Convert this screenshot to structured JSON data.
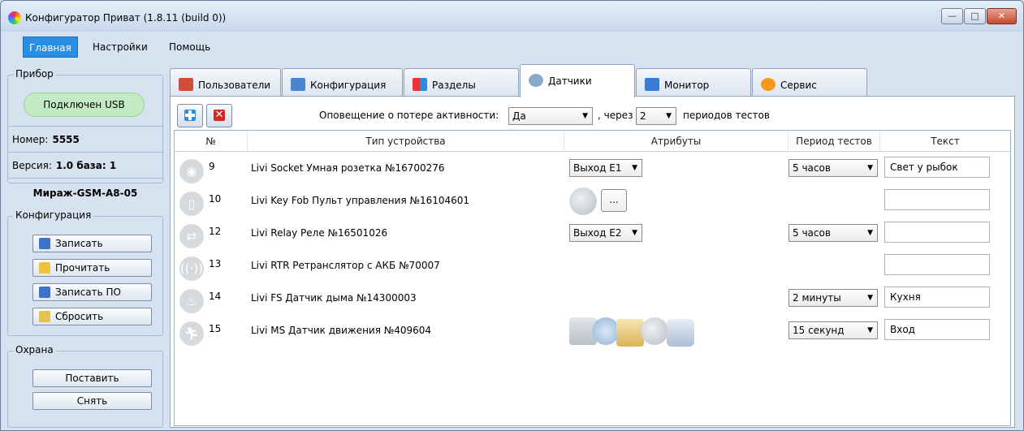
{
  "window": {
    "title": "Конфигуратор Приват (1.8.11 (build 0))",
    "minimize": "—",
    "maximize": "□",
    "close": "✕"
  },
  "menu": {
    "items": [
      "Главная",
      "Настройки",
      "Помощь"
    ]
  },
  "device": {
    "legend": "Прибор",
    "status": "Подключен USB",
    "status_color": "#c3ebc3",
    "number_label": "Номер:",
    "number_value": "5555",
    "version_label": "Версия:",
    "version_value": "1.0 база: 1",
    "model": "Мираж-GSM-A8-05"
  },
  "config": {
    "legend": "Конфигурация",
    "buttons": [
      "Записать",
      "Прочитать",
      "Записать ПО",
      "Сбросить"
    ]
  },
  "guard": {
    "legend": "Охрана",
    "buttons": [
      "Поставить",
      "Снять"
    ]
  },
  "tabs": [
    {
      "label": "Пользователи",
      "icon": "users-icon"
    },
    {
      "label": "Конфигурация",
      "icon": "tools-icon"
    },
    {
      "label": "Разделы",
      "icon": "sections-icon"
    },
    {
      "label": "Датчики",
      "icon": "sensors-icon"
    },
    {
      "label": "Монитор",
      "icon": "monitor-icon"
    },
    {
      "label": "Сервис",
      "icon": "service-icon"
    }
  ],
  "active_tab": "Датчики",
  "toolbar": {
    "notice_label": "Оповещение о потере активности:",
    "notice_value": "Да",
    "via_label": ", через",
    "periods_value": "2",
    "periods_label": "периодов тестов"
  },
  "table": {
    "columns": [
      "№",
      "Тип устройства",
      "Атрибуты",
      "Период тестов",
      "Текст"
    ],
    "rows": [
      {
        "num": "9",
        "type": "Livi Socket Умная розетка №16700276",
        "attr": "Выход Е1",
        "period": "5 часов",
        "text": "Свет у рыбок",
        "icon": "socket-icon"
      },
      {
        "num": "10",
        "type": "Livi Key Fob Пульт управления №16104601",
        "attr": "...",
        "period": "",
        "text": "",
        "icon": "keyfob-icon"
      },
      {
        "num": "12",
        "type": "Livi Relay Реле №16501026",
        "attr": "Выход Е2",
        "period": "5 часов",
        "text": "",
        "icon": "relay-icon"
      },
      {
        "num": "13",
        "type": "Livi RTR Ретранслятор с АКБ №70007",
        "attr": "",
        "period": "",
        "text": "",
        "icon": "repeater-icon"
      },
      {
        "num": "14",
        "type": "Livi FS Датчик дыма №14300003",
        "attr": "",
        "period": "2 минуты",
        "text": "Кухня",
        "icon": "smoke-icon"
      },
      {
        "num": "15",
        "type": "Livi MS Датчик движения №409604",
        "attr": "",
        "period": "15 секунд",
        "text": "Вход",
        "icon": "motion-icon"
      }
    ]
  }
}
